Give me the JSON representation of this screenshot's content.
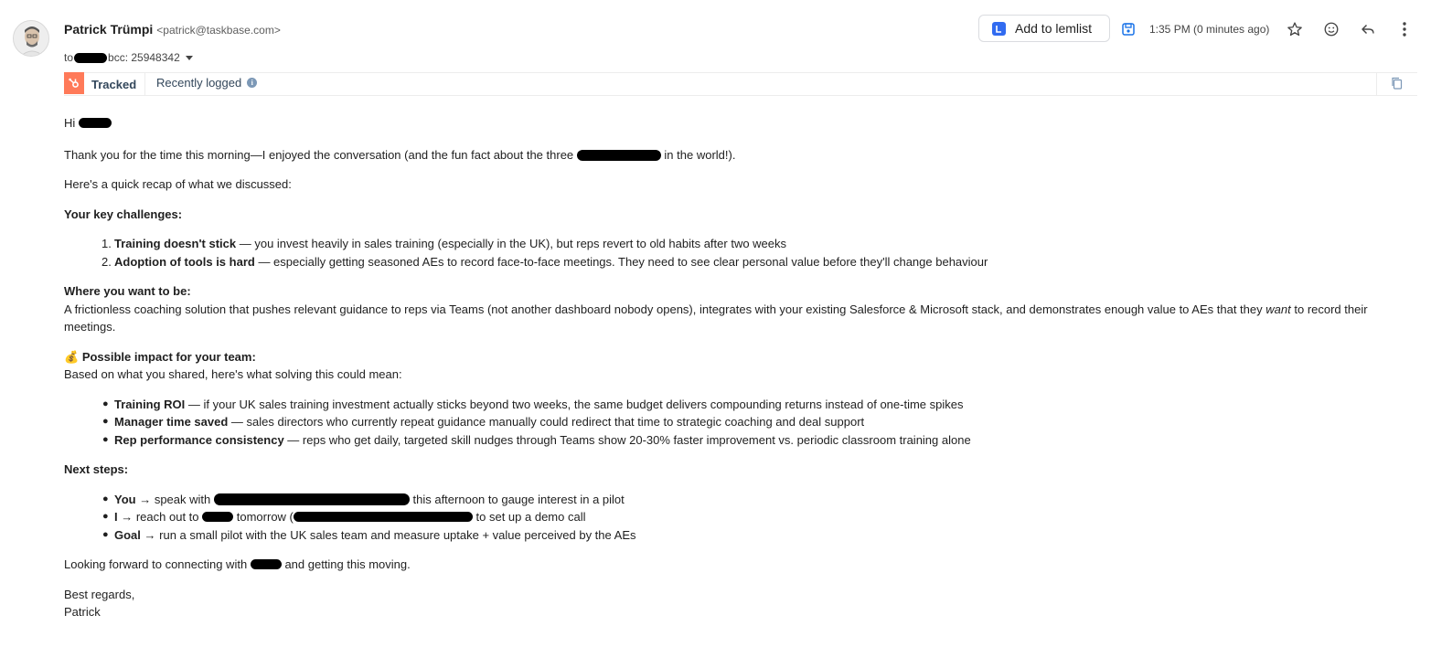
{
  "header": {
    "sender_name": "Patrick Trümpi",
    "sender_email": "<patrick@taskbase.com>",
    "to_prefix": "to",
    "bcc": "bcc: 25948342",
    "lemlist_label": "Add to lemlist",
    "timestamp": "1:35 PM (0 minutes ago)"
  },
  "tracking": {
    "tracked_label": "Tracked",
    "logged_label": "Recently logged"
  },
  "email": {
    "greeting": "Hi",
    "thanks_a": "Thank you for the time this morning—I enjoyed the conversation (and the fun fact about the three",
    "thanks_b": "in the world!).",
    "recap": "Here's a quick recap of what we discussed:",
    "challenges_heading": "Your key challenges:",
    "challenges": [
      {
        "num": "1.",
        "bold": "Training doesn't stick",
        "rest": " — you invest heavily in sales training (especially in the UK), but reps revert to old habits after two weeks"
      },
      {
        "num": "2.",
        "bold": "Adoption of tools is hard",
        "rest": " — especially getting seasoned AEs to record face-to-face meetings. They need to see clear personal value before they'll change behaviour"
      }
    ],
    "want_heading": "Where you want to be:",
    "want_a": "A frictionless coaching solution that pushes relevant guidance to reps via Teams (not another dashboard nobody opens), integrates with your existing Salesforce & Microsoft stack, and demonstrates enough value to AEs that they",
    "want_em": "want",
    "want_b": "to record their",
    "want_c": "meetings.",
    "impact_emoji": "💰",
    "impact_heading": "Possible impact for your team:",
    "impact_intro": "Based on what you shared, here's what solving this could mean:",
    "impacts": [
      {
        "bold": "Training ROI",
        "rest": " — if your UK sales training investment actually sticks beyond two weeks, the same budget delivers compounding returns instead of one-time spikes"
      },
      {
        "bold": "Manager time saved",
        "rest": " — sales directors who currently repeat guidance manually could redirect that time to strategic coaching and deal support"
      },
      {
        "bold": "Rep performance consistency",
        "rest": " — reps who get daily, targeted skill nudges through Teams show 20-30% faster improvement vs. periodic classroom training alone"
      }
    ],
    "next_heading": "Next steps:",
    "step1_bold": "You",
    "step1_a": " → speak with",
    "step1_b": "this afternoon to gauge interest in a pilot",
    "step2_bold": "I",
    "step2_a": " → reach out to",
    "step2_b": "tomorrow (",
    "step2_c": "to set up a demo call",
    "step3_bold": "Goal",
    "step3_rest": " → run a small pilot with the UK sales team and measure uptake + value perceived by the AEs",
    "closing_a": "Looking forward to connecting with",
    "closing_b": "and getting this moving.",
    "signoff": "Best regards,",
    "signature": "Patrick"
  }
}
